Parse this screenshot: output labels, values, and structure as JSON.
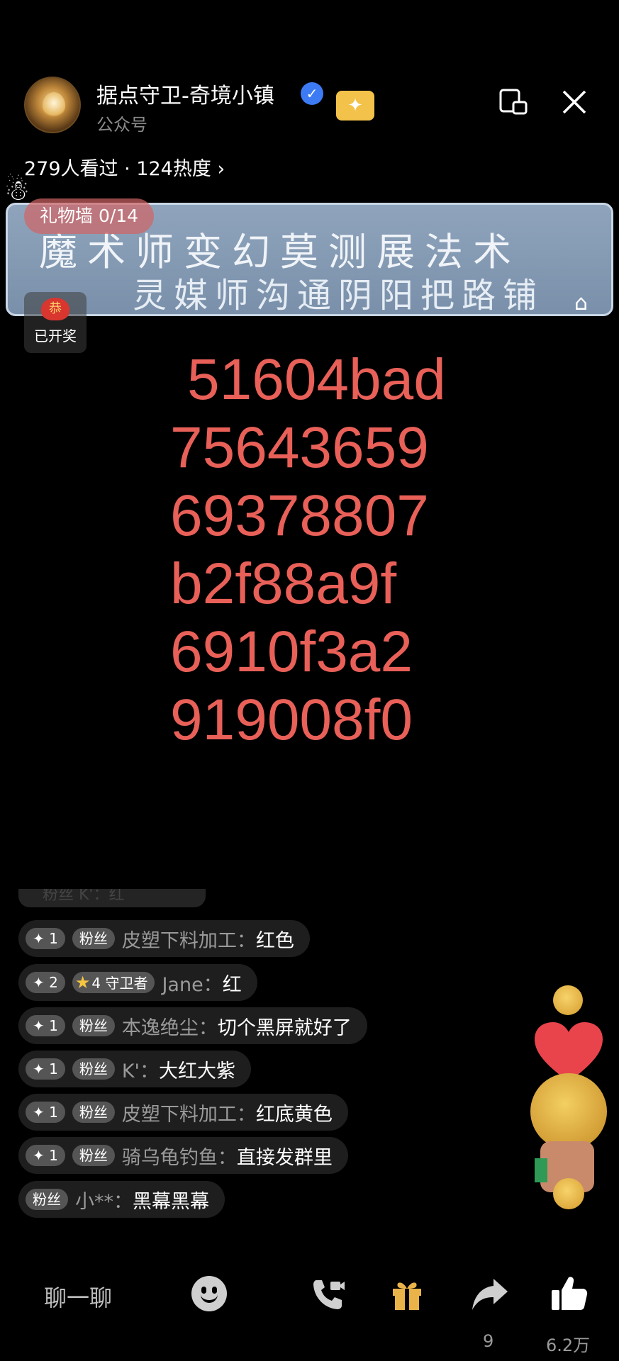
{
  "header": {
    "account_name": "据点守卫-奇境小镇",
    "account_type": "公众号",
    "stats": "279人看过 · 124热度 ›"
  },
  "banner": {
    "gift_wall": "礼物墙 0/14",
    "line1": "魔术师变幻莫测展法术",
    "line2": "灵媒师沟通阴阳把路铺"
  },
  "red_packet": {
    "label": "已开奖",
    "icon_char": "恭"
  },
  "codes": [
    "51604bad",
    "75643659",
    "69378807",
    "b2f88a9f",
    "6910f3a2",
    "919008f0"
  ],
  "comments": {
    "faded": "粉丝  K'：红",
    "items": [
      {
        "level": "✦ 1",
        "badge": "粉丝",
        "name": "皮塑下料加工：",
        "text": "红色"
      },
      {
        "level": "✦ 2",
        "badge_num": "4",
        "badge": "守卫者",
        "name": "Jane：",
        "text": "红"
      },
      {
        "level": "✦ 1",
        "badge": "粉丝",
        "name": "本逸绝尘：",
        "text": "切个黑屏就好了"
      },
      {
        "level": "✦ 1",
        "badge": "粉丝",
        "name": "K'：",
        "text": "大红大紫"
      },
      {
        "level": "✦ 1",
        "badge": "粉丝",
        "name": "皮塑下料加工：",
        "text": "红底黄色"
      },
      {
        "level": "✦ 1",
        "badge": "粉丝",
        "name": "骑乌龟钓鱼：",
        "text": "直接发群里"
      },
      {
        "badge": "粉丝",
        "name": "小**：",
        "text": "黑幕黑幕"
      }
    ]
  },
  "bottom_bar": {
    "chat_placeholder": "聊一聊",
    "share_count": "9",
    "like_count": "6.2万"
  },
  "colors": {
    "code_text": "#e86058",
    "banner_bg": "#8fa4bc",
    "verified": "#3d7bf5",
    "badge": "#f3c24a",
    "gift_wall_bg": "#d26464"
  },
  "icons": [
    "verified-icon",
    "badge-icon",
    "pip-icon",
    "close-icon",
    "snowman-icon",
    "house-icon",
    "redpack-icon",
    "heart-icon",
    "emoji-icon",
    "call-icon",
    "gift-icon",
    "share-icon",
    "like-icon"
  ]
}
